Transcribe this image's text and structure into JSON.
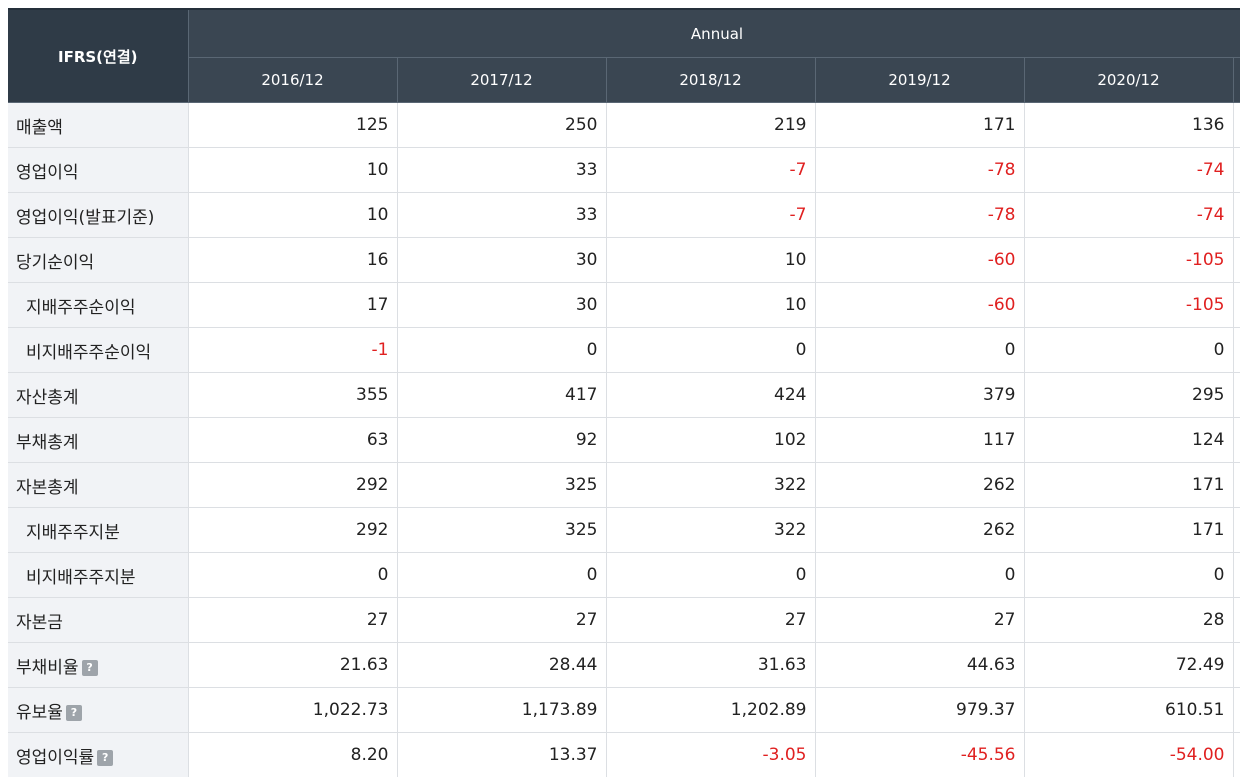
{
  "header": {
    "corner": "IFRS(연결)",
    "group": "Annual",
    "periods": [
      "2016/12",
      "2017/12",
      "2018/12",
      "2019/12",
      "2020/12"
    ]
  },
  "rows": [
    {
      "label": "매출액",
      "sub": false,
      "help": false,
      "values": [
        "125",
        "250",
        "219",
        "171",
        "136"
      ]
    },
    {
      "label": "영업이익",
      "sub": false,
      "help": false,
      "values": [
        "10",
        "33",
        "-7",
        "-78",
        "-74"
      ]
    },
    {
      "label": "영업이익(발표기준)",
      "sub": false,
      "help": false,
      "values": [
        "10",
        "33",
        "-7",
        "-78",
        "-74"
      ]
    },
    {
      "label": "당기순이익",
      "sub": false,
      "help": false,
      "values": [
        "16",
        "30",
        "10",
        "-60",
        "-105"
      ]
    },
    {
      "label": "지배주주순이익",
      "sub": true,
      "help": false,
      "values": [
        "17",
        "30",
        "10",
        "-60",
        "-105"
      ]
    },
    {
      "label": "비지배주주순이익",
      "sub": true,
      "help": false,
      "values": [
        "-1",
        "0",
        "0",
        "0",
        "0"
      ]
    },
    {
      "label": "자산총계",
      "sub": false,
      "help": false,
      "values": [
        "355",
        "417",
        "424",
        "379",
        "295"
      ]
    },
    {
      "label": "부채총계",
      "sub": false,
      "help": false,
      "values": [
        "63",
        "92",
        "102",
        "117",
        "124"
      ]
    },
    {
      "label": "자본총계",
      "sub": false,
      "help": false,
      "values": [
        "292",
        "325",
        "322",
        "262",
        "171"
      ]
    },
    {
      "label": "지배주주지분",
      "sub": true,
      "help": false,
      "values": [
        "292",
        "325",
        "322",
        "262",
        "171"
      ]
    },
    {
      "label": "비지배주주지분",
      "sub": true,
      "help": false,
      "values": [
        "0",
        "0",
        "0",
        "0",
        "0"
      ]
    },
    {
      "label": "자본금",
      "sub": false,
      "help": false,
      "values": [
        "27",
        "27",
        "27",
        "27",
        "28"
      ]
    },
    {
      "label": "부채비율",
      "sub": false,
      "help": true,
      "values": [
        "21.63",
        "28.44",
        "31.63",
        "44.63",
        "72.49"
      ]
    },
    {
      "label": "유보율",
      "sub": false,
      "help": true,
      "values": [
        "1,022.73",
        "1,173.89",
        "1,202.89",
        "979.37",
        "610.51"
      ]
    },
    {
      "label": "영업이익률",
      "sub": false,
      "help": true,
      "values": [
        "8.20",
        "13.37",
        "-3.05",
        "-45.56",
        "-54.00"
      ]
    }
  ],
  "help_icon": {
    "icon": "question-icon",
    "glyph": "?"
  },
  "colors": {
    "header_bg": "#3a4652",
    "label_bg": "#f1f3f6",
    "negative": "#e02020"
  }
}
